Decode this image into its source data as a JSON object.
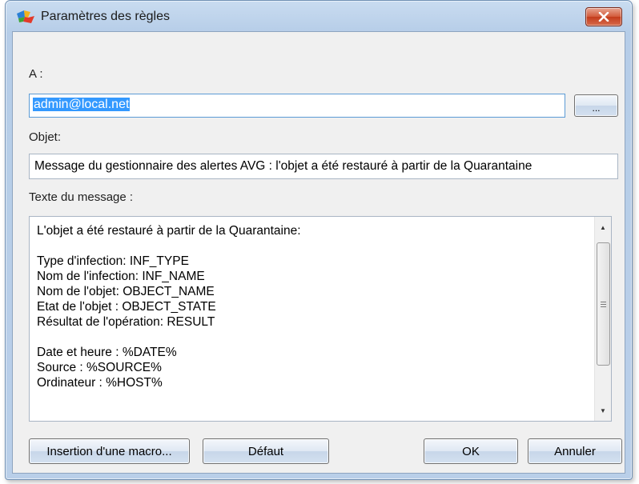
{
  "window": {
    "title": "Paramètres des règles"
  },
  "form": {
    "to_label": "A :",
    "to_value": "admin@local.net",
    "browse_label": "...",
    "subject_label": "Objet:",
    "subject_value": "Message du gestionnaire des alertes AVG : l'objet a été restauré à partir de la Quarantaine",
    "body_label": "Texte du message :",
    "body_lines": [
      "L'objet a été restauré à partir de la Quarantaine:",
      "",
      "Type d'infection: INF_TYPE",
      "Nom de l'infection: INF_NAME",
      "Nom de l'objet: OBJECT_NAME",
      "Etat de l'objet : OBJECT_STATE",
      "Résultat de l'opération: RESULT",
      "",
      "Date et heure : %DATE%",
      "Source : %SOURCE%",
      "Ordinateur : %HOST%"
    ]
  },
  "buttons": {
    "insert_macro": "Insertion d'une macro...",
    "default": "Défaut",
    "ok": "OK",
    "cancel": "Annuler"
  },
  "icons": {
    "app": "avg-logo-icon",
    "close": "close-icon",
    "scroll_up": "scroll-up-arrow-icon",
    "scroll_down": "scroll-down-arrow-icon"
  },
  "colors": {
    "selection": "#3399ff",
    "close_button": "#c43d1c",
    "frame": "#b9cfe9"
  }
}
